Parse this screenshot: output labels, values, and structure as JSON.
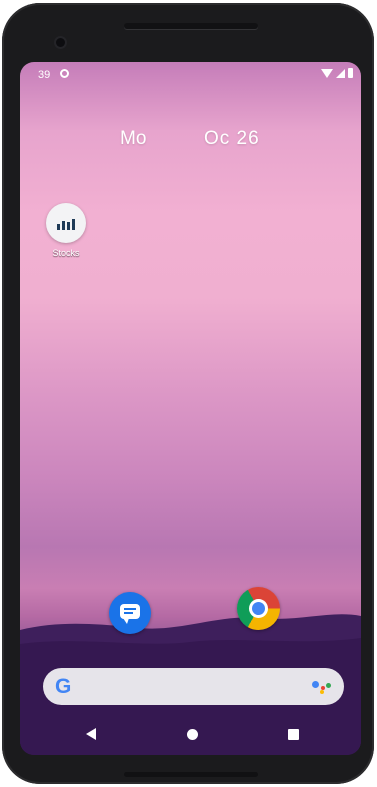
{
  "status_bar": {
    "time": "39"
  },
  "date_widget": {
    "day": "Mo",
    "date": "Oc 26"
  },
  "home_apps": [
    {
      "label": "Stocks",
      "icon": "stocks-icon"
    }
  ],
  "dock": [
    {
      "icon": "messages-icon"
    },
    {
      "icon": "chrome-icon"
    }
  ],
  "search_bar": {
    "logo": "G",
    "assistant_icon": "google-assistant-icon"
  },
  "nav_bar": {
    "back_icon": "back-icon",
    "home_icon": "home-icon",
    "recents_icon": "recents-icon"
  },
  "colors": {
    "wallpaper_top": "#c57db9",
    "wallpaper_mid": "#f2b0d2",
    "wallpaper_bottom": "#2d1344",
    "messages_blue": "#1a73e8",
    "search_bar_bg": "#e6e4ea"
  }
}
